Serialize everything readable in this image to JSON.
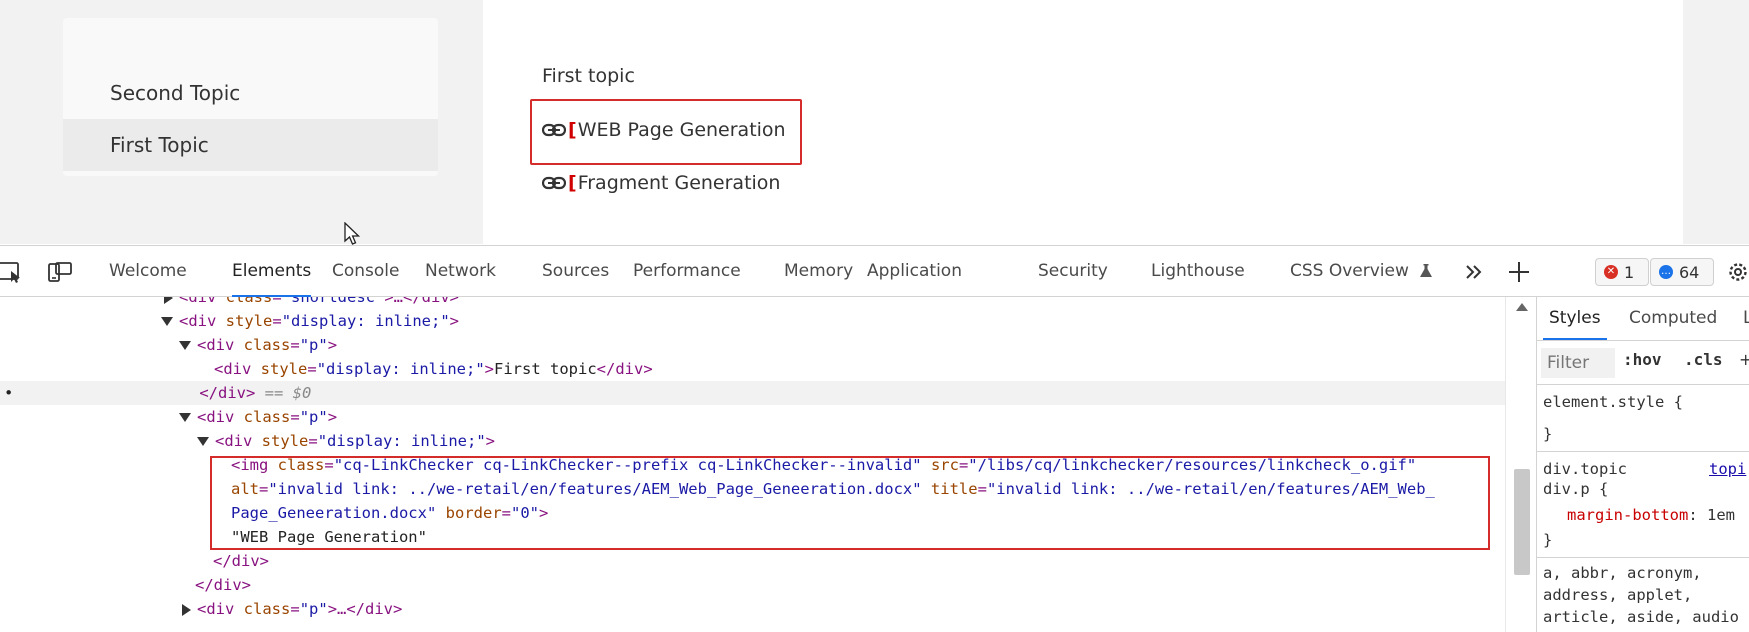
{
  "website": {
    "sidebar": {
      "items": [
        {
          "label": "Second Topic"
        },
        {
          "label": "First Topic",
          "selected": true
        }
      ]
    },
    "content": {
      "title": "First topic",
      "links": [
        {
          "label": "WEB Page Generation",
          "icon": "broken-link-chain-icon",
          "marker": "["
        },
        {
          "label": "Fragment Generation",
          "icon": "broken-link-chain-icon",
          "marker": "["
        }
      ]
    }
  },
  "devtools": {
    "tabs": [
      "Welcome",
      "Elements",
      "Console",
      "Network",
      "Sources",
      "Performance",
      "Memory",
      "Application",
      "Security",
      "Lighthouse",
      "CSS Overview"
    ],
    "active_tab": "Elements",
    "error_count": "1",
    "message_count": "64",
    "dom_lines": {
      "l0": {
        "open": "<div ",
        "attr": "class",
        "val": "\"shortdesc\"",
        "rest": ">…</div>"
      },
      "l1": {
        "open": "<div ",
        "attr": "style",
        "val": "\"display: inline;\"",
        "rest": ">"
      },
      "l2": {
        "open": "<div ",
        "attr": "class",
        "val": "\"p\"",
        "rest": ">"
      },
      "l3": {
        "open": "<div ",
        "attr": "style",
        "val": "\"display: inline;\"",
        "rest": ">",
        "text": "First topic",
        "close": "</div>"
      },
      "l4": {
        "close": "</div>",
        "suffix": " == $0"
      },
      "l5": {
        "open": "<div ",
        "attr": "class",
        "val": "\"p\"",
        "rest": ">"
      },
      "l6": {
        "open": "<div ",
        "attr": "style",
        "val": "\"display: inline;\"",
        "rest": ">"
      },
      "l7": {
        "open": "<img ",
        "attr1": "class",
        "val1": "\"cq-LinkChecker cq-LinkChecker--prefix cq-LinkChecker--invalid\"",
        "attr2": "src",
        "val2": "\"/libs/cq/linkchecker/resources/linkcheck_o.gif\""
      },
      "l8": {
        "attr1": "alt",
        "val1": "\"invalid link: ../we-retail/en/features/AEM_Web_Page_Geneeration.docx\"",
        "attr2": "title",
        "val2": "\"invalid link: ../we-retail/en/features/AEM_Web_"
      },
      "l9": {
        "val1": "Page_Geneeration.docx\"",
        "attr2": "border",
        "val2": "\"0\"",
        "rest": ">"
      },
      "l10": {
        "text": "\"WEB Page Generation\""
      },
      "l11": {
        "close": "</div>"
      },
      "l12": {
        "close": "</div>"
      },
      "l13": {
        "open": "<div ",
        "attr": "class",
        "val": "\"p\"",
        "rest": ">…</div>"
      }
    },
    "styles_panel": {
      "tabs": [
        "Styles",
        "Computed",
        "L"
      ],
      "filter_placeholder": "Filter",
      "hov": ":hov",
      "cls": ".cls",
      "add": "+",
      "rule1_selector": "element.style {",
      "rule1_close": "}",
      "rule2_selector_a": "div.topic",
      "rule2_source": "topi",
      "rule2_selector_b": "div.p {",
      "rule2_prop": "margin-bottom",
      "rule2_value": ": 1em",
      "rule2_close": "}",
      "rule3_line1": "a, abbr, acronym,",
      "rule3_line2": "address, applet,",
      "rule3_line3": "article, aside, audio"
    }
  }
}
